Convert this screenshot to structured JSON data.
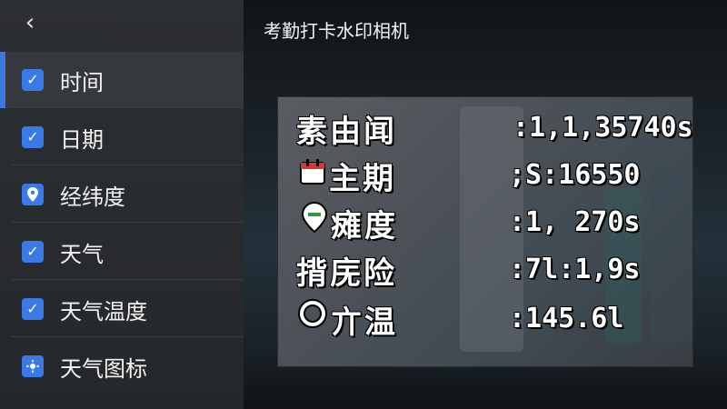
{
  "header": {
    "back_icon": "chevron-left-icon",
    "title": "考勤打卡水印相机"
  },
  "sidebar": {
    "items": [
      {
        "label": "时间",
        "icon": "checkbox-checked-icon",
        "selected": true
      },
      {
        "label": "日期",
        "icon": "checkbox-checked-icon"
      },
      {
        "label": "经纬度",
        "icon": "location-pin-icon"
      },
      {
        "label": "天气",
        "icon": "checkbox-checked-icon"
      },
      {
        "label": "天气温度",
        "icon": "checkbox-checked-icon"
      },
      {
        "label": "天气图标",
        "icon": "weather-icon"
      }
    ]
  },
  "watermark": {
    "rows": [
      {
        "label": "素由闻",
        "value": ":1,1,35740s"
      },
      {
        "label": "主期",
        "value": ";S:16550",
        "icon": "calendar-icon"
      },
      {
        "label": "瘫度",
        "value": ":1, 270s",
        "icon": "location-pin-icon"
      },
      {
        "label": "揹庑险",
        "value": ":7l:1,9s"
      },
      {
        "label": "亣温",
        "value": ":145.6l",
        "icon": "circle-icon"
      }
    ]
  },
  "colors": {
    "accent": "#3a7ae8",
    "sidebar_bg": "#2c2f33"
  }
}
